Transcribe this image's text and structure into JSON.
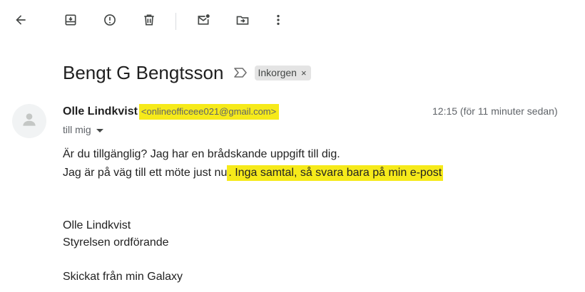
{
  "toolbar": {
    "icons": [
      "arrow-back-icon",
      "archive-icon",
      "report-spam-icon",
      "delete-icon",
      "mark-unread-icon",
      "move-to-icon",
      "more-vert-icon"
    ]
  },
  "email": {
    "subject": "Bengt G Bengtsson",
    "label": "Inkorgen",
    "label_close": "×",
    "sender_name": "Olle Lindkvist",
    "sender_email": "<onlineofficeee021@gmail.com>",
    "timestamp": "12:15 (för 11 minuter sedan)",
    "recipient": "till mig",
    "body_line1": "Är du tillgänglig? Jag har en brådskande uppgift till dig.",
    "body_line2_plain": "Jag är på väg till ett möte just nu",
    "body_line2_highlight": ". Inga samtal, så svara bara på min e-post",
    "signature_name": "Olle Lindkvist",
    "signature_title": "Styrelsen ordförande",
    "footer": "Skickat från min Galaxy"
  },
  "colors": {
    "highlight": "#f6ea1a",
    "icon": "#444746",
    "text_secondary": "#5f6368"
  }
}
